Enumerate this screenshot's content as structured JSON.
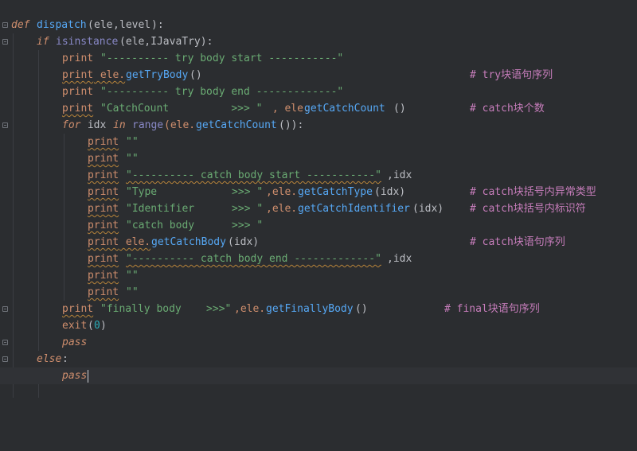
{
  "editor": {
    "lines": [
      [
        "def",
        " ",
        "dispatch",
        "(",
        "ele",
        ",",
        "level",
        "):"
      ],
      [
        "if",
        " ",
        "isinstance",
        "(ele,IJavaTry):"
      ],
      [
        "print",
        " ",
        "\"---------- try body start -----------\""
      ],
      [
        "print",
        " ele.",
        "getTryBody",
        "()",
        "# try块语句序列"
      ],
      [
        "print",
        " ",
        "\"---------- try body end -------------\""
      ],
      [
        "print",
        " ",
        "\"CatchCount          >>> \"",
        " , ele.",
        "getCatchCount",
        "()",
        "# catch块个数"
      ],
      [
        "for",
        " idx ",
        "in",
        " ",
        "range",
        "(ele.",
        "getCatchCount",
        "()):"
      ],
      [
        "print",
        " ",
        "\"\""
      ],
      [
        "print",
        " ",
        "\"\""
      ],
      [
        "print",
        " ",
        "\"---------- catch body start -----------\"",
        ",idx"
      ],
      [
        "print",
        " ",
        "\"Type            >>> \"",
        ",ele.",
        "getCatchType",
        "(idx)",
        "# catch块括号内异常类型"
      ],
      [
        "print",
        " ",
        "\"Identifier      >>> \"",
        ",ele.",
        "getCatchIdentifier",
        "(idx)",
        "# catch块括号内标识符"
      ],
      [
        "print",
        " ",
        "\"catch body      >>> \""
      ],
      [
        "print",
        " ele.",
        "getCatchBody",
        "(idx)",
        "# catch块语句序列"
      ],
      [
        "print",
        " ",
        "\"---------- catch body end -------------\"",
        ",idx"
      ],
      [
        "print",
        " ",
        "\"\""
      ],
      [
        "print",
        " ",
        "\"\""
      ],
      [
        "print",
        " ",
        "\"finally body    >>>\"",
        ",ele.",
        "getFinallyBody",
        "()",
        "# final块语句序列"
      ],
      [
        "exit",
        "(",
        "0",
        ")"
      ],
      [
        "pass"
      ],
      [
        "else",
        ":"
      ],
      [
        "pass"
      ]
    ]
  },
  "colors": {
    "background": "#2b2d30",
    "keyword": "#cf8e6d",
    "function": "#56a8f5",
    "builtin": "#8888c6",
    "string": "#6aab73",
    "number": "#2aacb8",
    "comment": "#c77dbb",
    "text": "#bcbec4"
  }
}
